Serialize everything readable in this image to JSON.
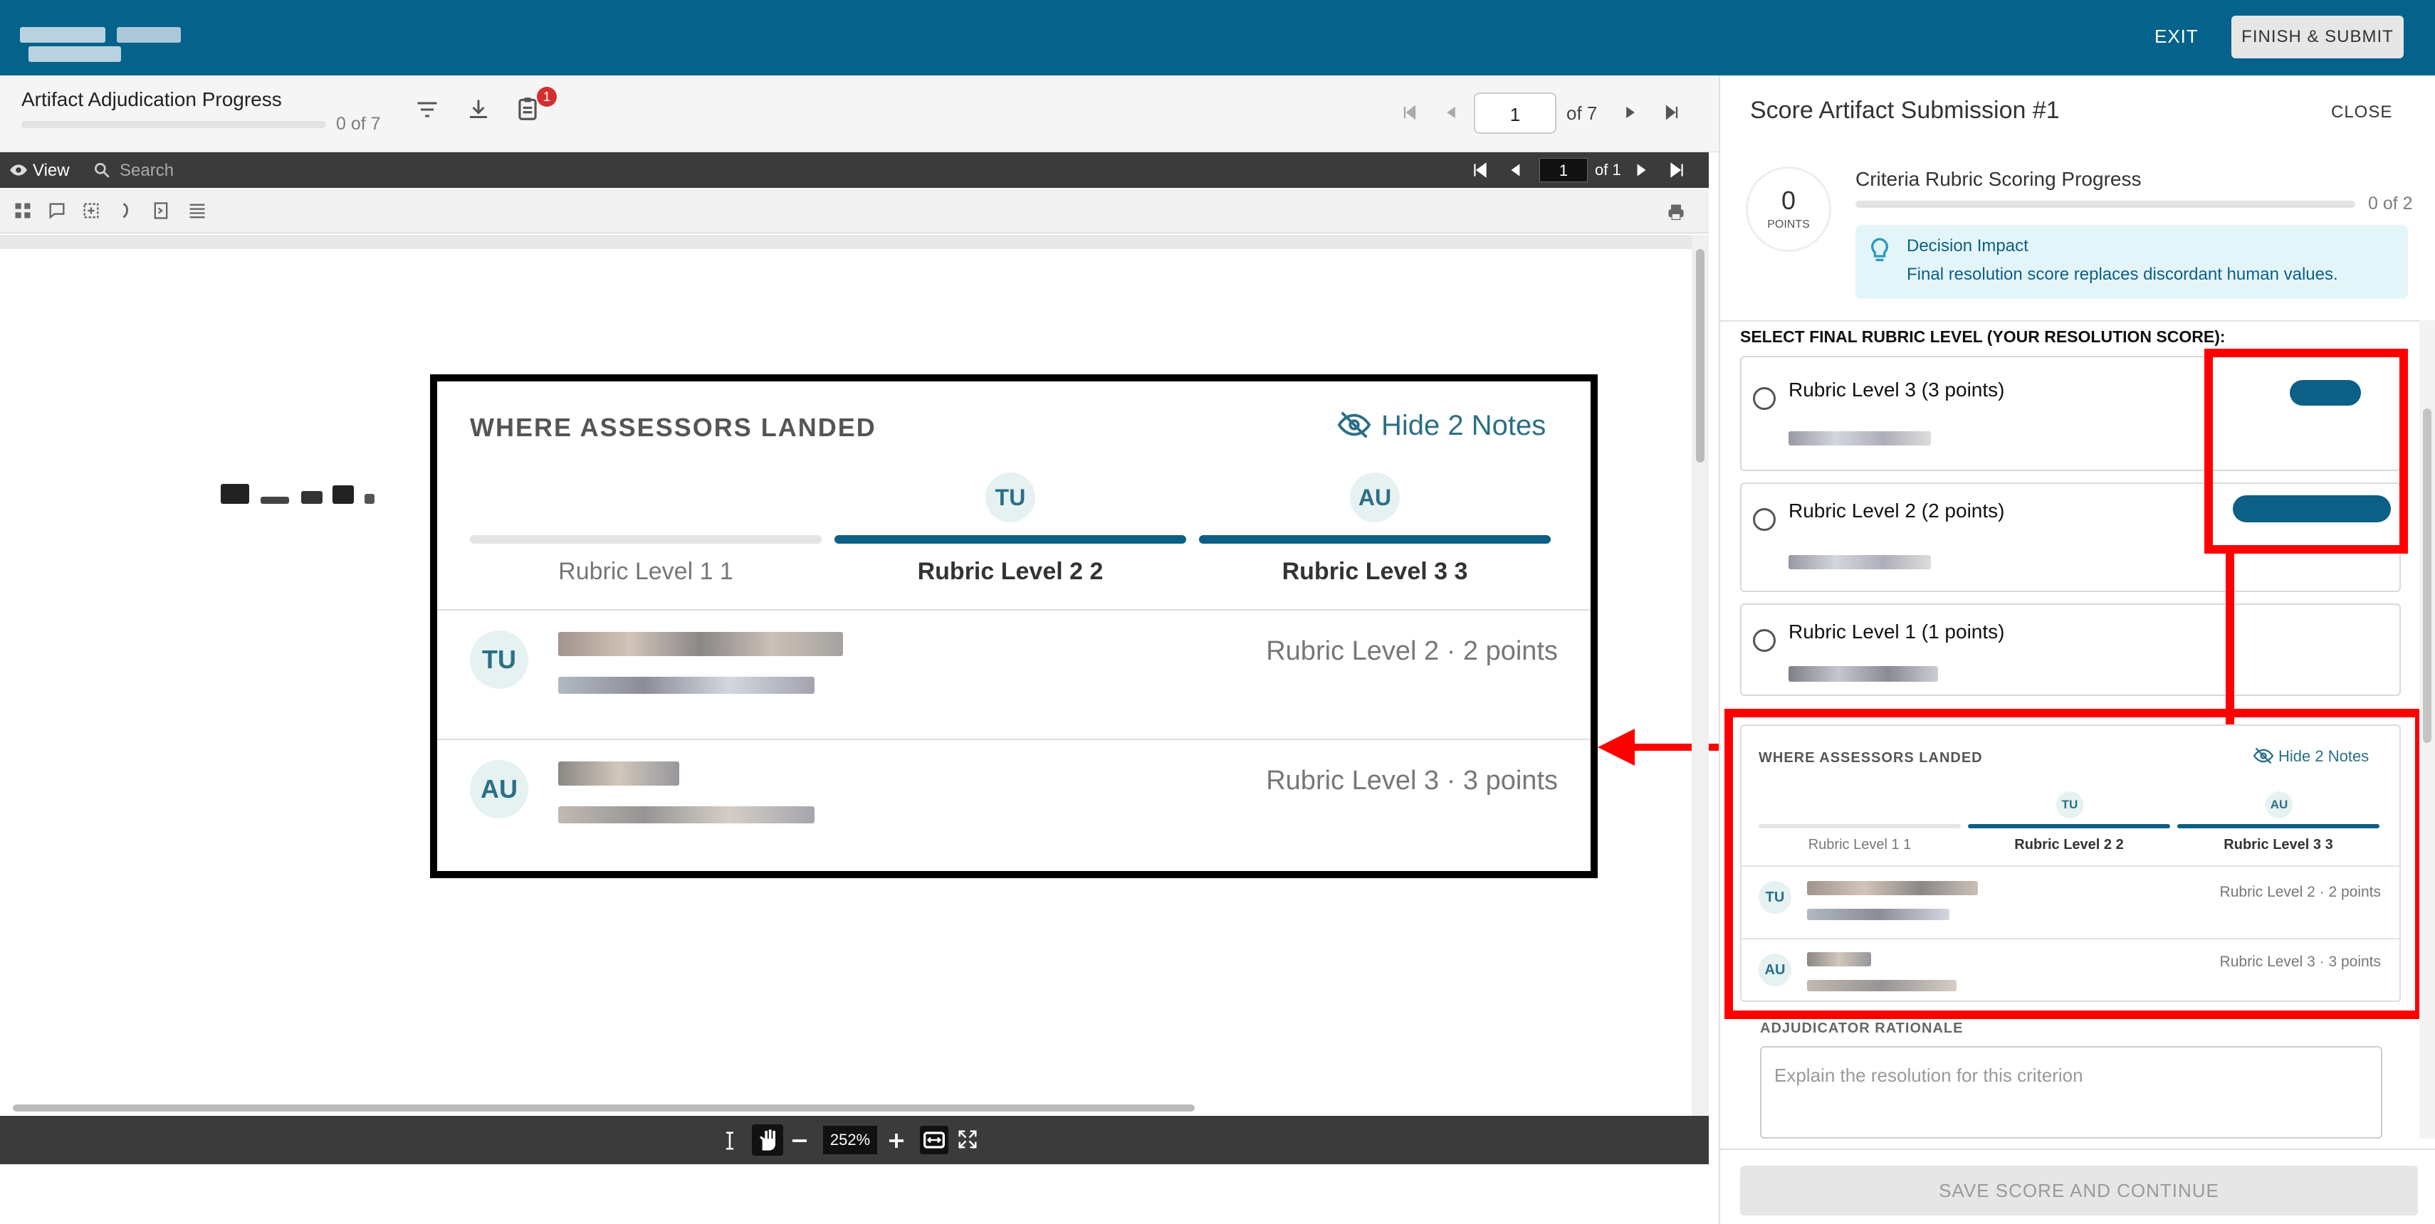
{
  "topbar": {
    "exit": "EXIT",
    "finish": "FINISH & SUBMIT"
  },
  "progress": {
    "title": "Artifact Adjudication Progress",
    "count": "0 of 7",
    "fraction": 0,
    "badge": "1"
  },
  "pager": {
    "page": "1",
    "of": "of 7"
  },
  "viewer": {
    "view": "View",
    "search_placeholder": "Search",
    "page": "1",
    "of": "of 1",
    "zoom": "252%"
  },
  "panel": {
    "title": "Score Artifact Submission #1",
    "close": "CLOSE",
    "points_value": "0",
    "points_label": "POINTS",
    "criteria_title": "Criteria Rubric Scoring Progress",
    "criteria_count": "0 of 2",
    "criteria_fraction": 0,
    "impact_title": "Decision Impact",
    "impact_text": "Final resolution score replaces discordant human values.",
    "select_heading": "SELECT FINAL RUBRIC LEVEL (YOUR RESOLUTION SCORE):",
    "levels": [
      {
        "label": "Rubric Level 3 (3 points)"
      },
      {
        "label": "Rubric Level 2 (2 points)"
      },
      {
        "label": "Rubric Level 1 (1 points)"
      }
    ],
    "rationale_label": "ADJUDICATOR RATIONALE",
    "rationale_placeholder": "Explain the resolution for this criterion",
    "save": "SAVE SCORE AND CONTINUE"
  },
  "assessors": {
    "heading": "WHERE ASSESSORS LANDED",
    "hide": "Hide 2 Notes",
    "columns": [
      {
        "label": "Rubric Level 1 1",
        "avatar": ""
      },
      {
        "label": "Rubric Level 2 2",
        "avatar": "TU"
      },
      {
        "label": "Rubric Level 3 3",
        "avatar": "AU"
      }
    ],
    "rows": [
      {
        "avatar": "TU",
        "score": "Rubric Level 2 · 2 points"
      },
      {
        "avatar": "AU",
        "score": "Rubric Level 3 · 3 points"
      }
    ]
  },
  "colors": {
    "topbar": "#05628a",
    "accent": "#0c5f86",
    "highlight": "#ff0000"
  }
}
